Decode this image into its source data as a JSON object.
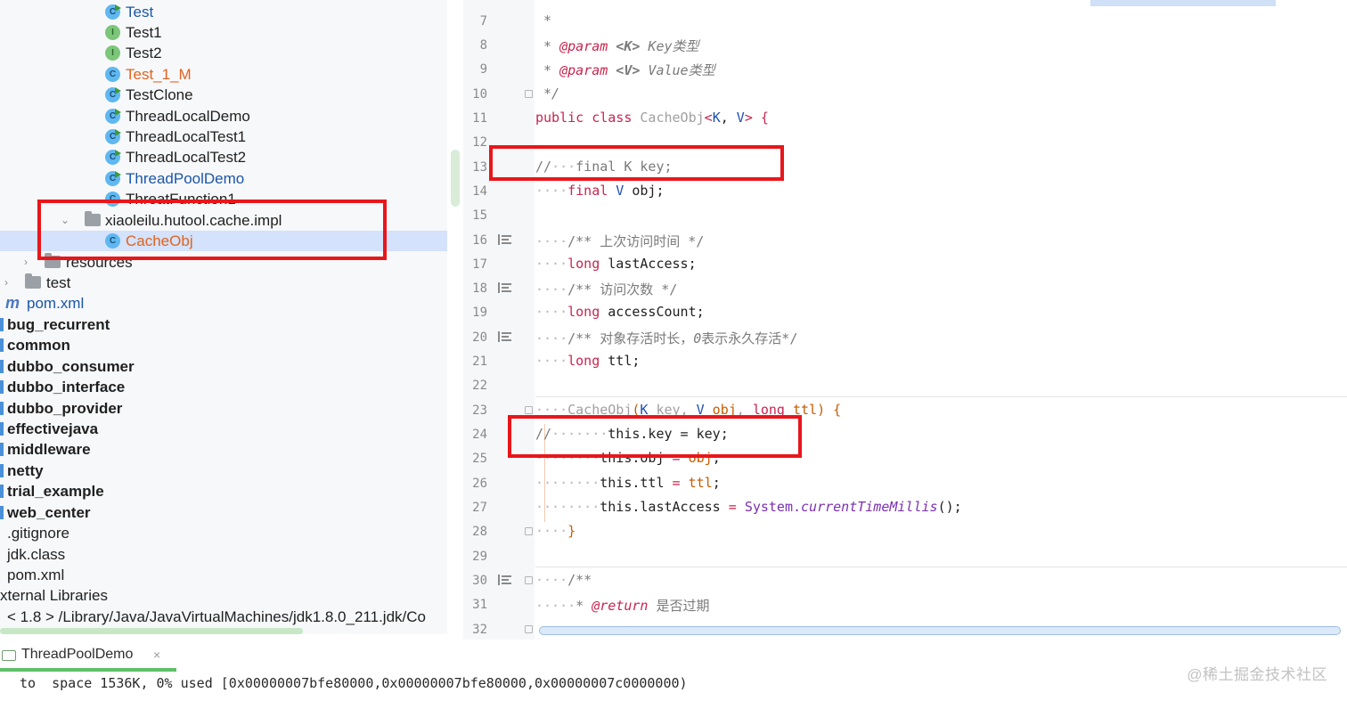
{
  "tree": {
    "items": [
      {
        "label": "Test"
      },
      {
        "label": "Test1"
      },
      {
        "label": "Test2"
      },
      {
        "label": "Test_1_M"
      },
      {
        "label": "TestClone"
      },
      {
        "label": "ThreadLocalDemo"
      },
      {
        "label": "ThreadLocalTest1"
      },
      {
        "label": "ThreadLocalTest2"
      },
      {
        "label": "ThreadPoolDemo"
      },
      {
        "label": "ThreatFunction1"
      },
      {
        "label": "xiaoleilu.hutool.cache.impl"
      },
      {
        "label": "CacheObj"
      },
      {
        "label": "resources"
      },
      {
        "label": "test"
      },
      {
        "label": "pom.xml"
      },
      {
        "label": "bug_recurrent"
      },
      {
        "label": "common"
      },
      {
        "label": "dubbo_consumer"
      },
      {
        "label": "dubbo_interface"
      },
      {
        "label": "dubbo_provider"
      },
      {
        "label": "effectivejava"
      },
      {
        "label": "middleware"
      },
      {
        "label": "netty"
      },
      {
        "label": "trial_example"
      },
      {
        "label": "web_center"
      },
      {
        "label": ".gitignore"
      },
      {
        "label": "jdk.class"
      },
      {
        "label": "pom.xml"
      },
      {
        "label": "xternal Libraries"
      },
      {
        "label": "< 1.8 > /Library/Java/JavaVirtualMachines/jdk1.8.0_211.jdk/Co"
      }
    ]
  },
  "editor": {
    "line_numbers": [
      "7",
      "8",
      "9",
      "10",
      "11",
      "12",
      "13",
      "14",
      "15",
      "16",
      "17",
      "18",
      "19",
      "20",
      "21",
      "22",
      "23",
      "24",
      "25",
      "26",
      "27",
      "28",
      "29",
      "30",
      "31",
      "32"
    ],
    "code": {
      "l7": "*",
      "l8_a": "* ",
      "l8_tag": "@param",
      "l8_b": " <K>",
      "l8_c": " Key类型",
      "l9_a": "* ",
      "l9_tag": "@param",
      "l9_b": " <V>",
      "l9_c": " Value类型",
      "l10": "*/",
      "l11_a": "public class",
      "l11_b": " CacheObj",
      "l11_c": "<",
      "l11_d": "K",
      "l11_e": ", ",
      "l11_f": "V",
      "l11_g": "> {",
      "l13_a": "//",
      "l13_b": "final K key;",
      "l14_a": "final",
      "l14_b": " V",
      "l14_c": " obj;",
      "l16": "/** 上次访问时间 */",
      "l17_a": "long",
      "l17_b": " lastAccess;",
      "l18": "/** 访问次数 */",
      "l19_a": "long",
      "l19_b": " accessCount;",
      "l20_a": "/** 对象存活时长，",
      "l20_b": "0",
      "l20_c": "表示永久存活*/",
      "l21_a": "long",
      "l21_b": " ttl;",
      "l23_a": "CacheObj",
      "l23_b": "(",
      "l23_c": "K",
      "l23_d": " key",
      "l23_e": ", ",
      "l23_f": "V",
      "l23_g": " obj",
      "l23_h": ", ",
      "l23_i": "long",
      "l23_j": " ttl",
      "l23_k": ") {",
      "l24_a": "//",
      "l24_b": "this.key = key;",
      "l25_a": "this.obj",
      "l25_b": " = ",
      "l25_c": "obj",
      "l25_d": ";",
      "l26_a": "this.ttl",
      "l26_b": " = ",
      "l26_c": "ttl",
      "l26_d": ";",
      "l27_a": "this.lastAccess",
      "l27_b": " = ",
      "l27_c": "System.",
      "l27_d": "currentTimeMillis",
      "l27_e": "();",
      "l28": "}",
      "l30": "/**",
      "l31_a": "* ",
      "l31_tag": "@return",
      "l31_b": " 是否过期"
    }
  },
  "run": {
    "tab_label": "ThreadPoolDemo",
    "tab_close": "×",
    "console_line": "to  space 1536K, 0% used [0x00000007bfe80000,0x00000007bfe80000,0x00000007c0000000)"
  },
  "watermark": "@稀土掘金技术社区",
  "colors": {
    "highlight_box": "#e8161b",
    "selection": "#d4e2fb",
    "keyword": "#c7254e",
    "type_param": "#1f4fb3",
    "orange_label": "#e0631f",
    "blue_label": "#1a56a8"
  },
  "icons": [
    "class-icon",
    "interface-icon",
    "package-icon",
    "folder-icon",
    "maven-icon",
    "run-config-icon",
    "close-icon",
    "chevron-down-icon",
    "chevron-right-icon",
    "doc-comment-icon",
    "fold-icon"
  ]
}
